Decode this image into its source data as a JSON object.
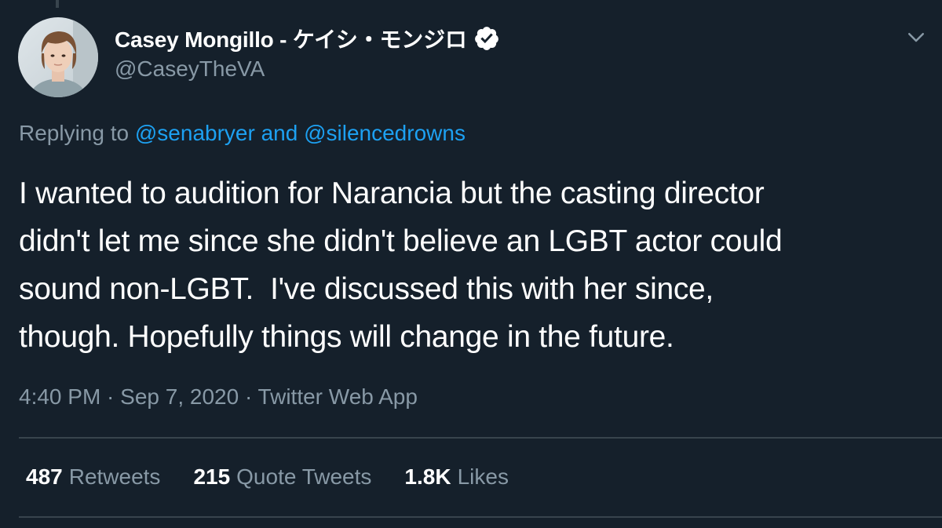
{
  "author": {
    "display_name": "Casey Mongillo - ケイシ・モンジロ",
    "handle": "@CaseyTheVA",
    "verified": true
  },
  "replying": {
    "prefix": "Replying to ",
    "mention_1": "@senabryer",
    "conjunction": " and ",
    "mention_2": "@silencedrowns"
  },
  "tweet_text": "I wanted to audition for Narancia but the casting director\ndidn't let me since she didn't believe an LGBT actor could\nsound non-LGBT.  I've discussed this with her since,\nthough. Hopefully things will change in the future.",
  "meta": "4:40 PM · Sep 7, 2020 · Twitter Web App",
  "stats": {
    "retweets_count": "487",
    "retweets_label": "Retweets",
    "quotes_count": "215",
    "quotes_label": "Quote Tweets",
    "likes_count": "1.8K",
    "likes_label": "Likes"
  },
  "colors": {
    "background": "#15202b",
    "secondary_text": "#8899a6",
    "link": "#1da1f2",
    "divider": "#38444d"
  },
  "icons": {
    "verified": "verified-badge-icon",
    "caret": "chevron-down-icon"
  }
}
